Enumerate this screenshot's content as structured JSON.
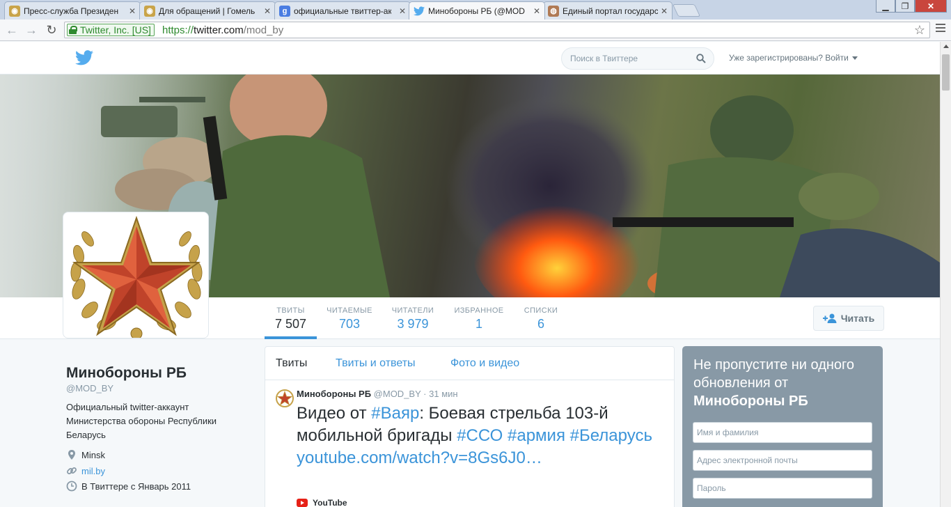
{
  "browser": {
    "tabs": [
      {
        "title": "Пресс-служба Президен",
        "icon": "coat-of-arms-icon",
        "active": false
      },
      {
        "title": "Для обращений | Гомель",
        "icon": "coat-of-arms-icon",
        "active": false
      },
      {
        "title": "официальные твиттер-ак",
        "icon": "google-icon",
        "active": false
      },
      {
        "title": "Минобороны РБ (@MOD",
        "icon": "twitter-bird-icon",
        "active": true
      },
      {
        "title": "Единый портал государс",
        "icon": "globe-icon",
        "active": false
      }
    ],
    "ev_label": "Twitter, Inc. [US]",
    "url_scheme": "https://",
    "url_host": "twitter.com",
    "url_path": "/mod_by"
  },
  "topbar": {
    "search_placeholder": "Поиск в Твиттере",
    "login_label": "Уже зарегистрированы? Войти"
  },
  "profile_nav": {
    "stats": [
      {
        "label": "ТВИТЫ",
        "value": "7 507",
        "active": true
      },
      {
        "label": "ЧИТАЕМЫЕ",
        "value": "703",
        "active": false
      },
      {
        "label": "ЧИТАТЕЛИ",
        "value": "3 979",
        "active": false
      },
      {
        "label": "ИЗБРАННОЕ",
        "value": "1",
        "active": false
      },
      {
        "label": "СПИСКИ",
        "value": "6",
        "active": false
      }
    ],
    "follow_label": "Читать"
  },
  "profile": {
    "name": "Минобороны РБ",
    "handle": "@MOD_BY",
    "bio": "Официальный twitter-аккаунт Министерства обороны Республики Беларусь",
    "location": "Minsk",
    "website": "mil.by",
    "joined": "В Твиттере с Январь 2011"
  },
  "timeline": {
    "tabs": [
      "Твиты",
      "Твиты и ответы",
      "Фото и видео"
    ],
    "tweet": {
      "name": "Минобороны РБ",
      "handle": "@MOD_BY",
      "time": "31 мин",
      "text_parts": [
        {
          "t": "Видео от ",
          "hl": false
        },
        {
          "t": "#Ваяр",
          "hl": true
        },
        {
          "t": ": Боевая стрельба 103-й мобильной бригады ",
          "hl": false
        },
        {
          "t": "#ССО",
          "hl": true
        },
        {
          "t": " ",
          "hl": false
        },
        {
          "t": "#армия",
          "hl": true
        },
        {
          "t": " ",
          "hl": false
        },
        {
          "t": "#Беларусь",
          "hl": true
        },
        {
          "t": " ",
          "hl": false
        },
        {
          "t": "youtube.com/watch?v=8Gs6J0…",
          "hl": true
        }
      ],
      "card_source": "YouTube"
    }
  },
  "signup": {
    "title_line": "Не пропустите ни одного обновления от",
    "title_name": "Минобороны РБ",
    "name_placeholder": "Имя и фамилия",
    "email_placeholder": "Адрес электронной почты",
    "password_placeholder": "Пароль"
  },
  "colors": {
    "link_blue": "#3b94d9",
    "text_dark": "#292f33",
    "muted": "#8899a6",
    "signup_bg": "#8899a6"
  }
}
